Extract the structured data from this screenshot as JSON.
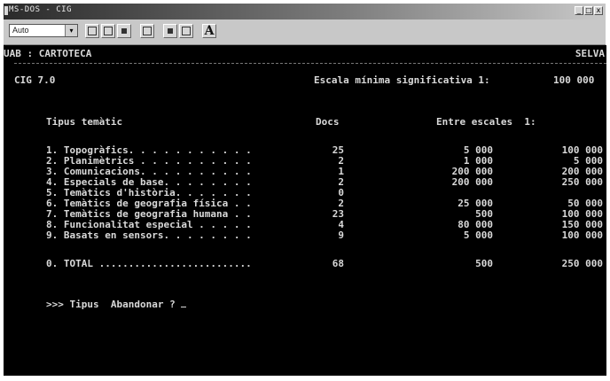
{
  "window": {
    "title": "MS-DOS - CIG",
    "buttons": [
      "_",
      "□",
      "x"
    ]
  },
  "toolbar": {
    "font_size": "Auto",
    "font_button_label": "A"
  },
  "terminal": {
    "header_left": "UAB : CARTOTECA",
    "header_right": "SELVA",
    "app_version": "CIG 7.0",
    "scale_label": "Escala mínima significativa 1:",
    "scale_value": "100 000",
    "table": {
      "col_type": "Tipus temàtic",
      "col_docs": "Docs",
      "col_scales": "Entre escales  1:",
      "rows": [
        {
          "label": "1. Topogràfics. . . . . . . . . . .",
          "docs": "25",
          "min": "5 000",
          "max": "100 000"
        },
        {
          "label": "2. Planimètrics . . . . . . . . . .",
          "docs": "2",
          "min": "1 000",
          "max": "5 000"
        },
        {
          "label": "3. Comunicacions. . . . . . . . . .",
          "docs": "1",
          "min": "200 000",
          "max": "200 000"
        },
        {
          "label": "4. Especials de base. . . . . . . .",
          "docs": "2",
          "min": "200 000",
          "max": "250 000"
        },
        {
          "label": "5. Temàtics d'història. . . . . . .",
          "docs": "0",
          "min": "",
          "max": ""
        },
        {
          "label": "6. Temàtics de geografia física . .",
          "docs": "2",
          "min": "25 000",
          "max": "50 000"
        },
        {
          "label": "7. Temàtics de geografia humana . .",
          "docs": "23",
          "min": "500",
          "max": "100 000"
        },
        {
          "label": "8. Funcionalitat especial . . . . .",
          "docs": "4",
          "min": "80 000",
          "max": "150 000"
        },
        {
          "label": "9. Basats en sensors. . . . . . . .",
          "docs": "9",
          "min": "5 000",
          "max": "100 000"
        }
      ],
      "total_label": "0. TOTAL ..........................",
      "total_docs": "68",
      "total_min": "500",
      "total_max": "250 000"
    },
    "prompt": ">>> Tipus  Abandonar ? "
  }
}
